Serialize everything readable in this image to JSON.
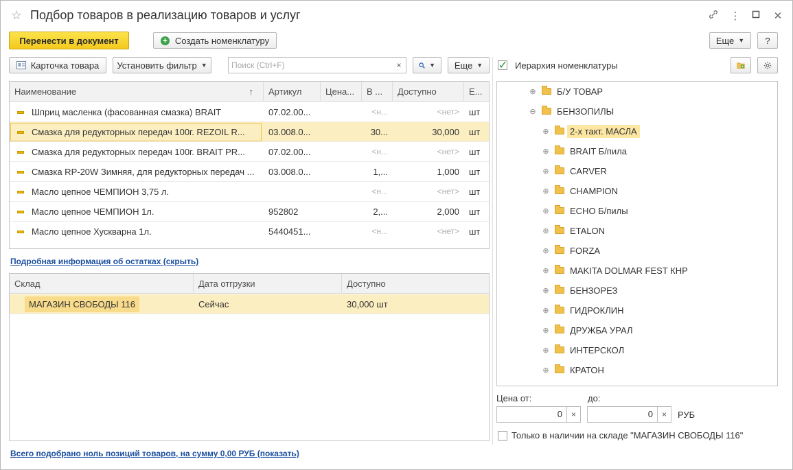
{
  "window": {
    "title": "Подбор товаров в реализацию товаров и услуг",
    "star_icon": "☆",
    "link_icon": "🔗",
    "more_icon": "⋮",
    "maximize_icon": "☐",
    "close_icon": "✕"
  },
  "toolbar": {
    "transfer_label": "Перенести в документ",
    "create_item_label": "Создать номенклатуру",
    "more_label": "Еще",
    "help_label": "?"
  },
  "list_toolbar": {
    "item_card_label": "Карточка товара",
    "set_filter_label": "Установить фильтр",
    "search_placeholder": "Поиск (Ctrl+F)",
    "search_value": "",
    "clear_label": "×",
    "search_icon_glyph": "🔍",
    "more_label": "Еще"
  },
  "goods_table": {
    "columns": [
      "Наименование",
      "Артикул",
      "Цена...",
      "В ...",
      "Доступно",
      "Е..."
    ],
    "sort_arrow": "↑",
    "rows": [
      {
        "name": "Шприц масленка (фасованная смазка) BRAIT",
        "article": "07.02.00...",
        "price": "",
        "in": "<н...",
        "available": "<нет>",
        "unit": "шт"
      },
      {
        "name": "Смазка для редукторных передач  100г.  REZOIL R...",
        "article": "03.008.0...",
        "price": "",
        "in": "30...",
        "available": "30,000",
        "unit": "шт"
      },
      {
        "name": "Смазка для редукторных передач  100г.  BRAIT PR...",
        "article": "07.02.00...",
        "price": "",
        "in": "<н...",
        "available": "<нет>",
        "unit": "шт"
      },
      {
        "name": "Смазка RP-20W Зимняя, для редукторных передач ...",
        "article": "03.008.0...",
        "price": "",
        "in": "1,...",
        "available": "1,000",
        "unit": "шт"
      },
      {
        "name": "Масло цепное ЧЕМПИОН   3,75 л.",
        "article": "",
        "price": "",
        "in": "<н...",
        "available": "<нет>",
        "unit": "шт"
      },
      {
        "name": "Масло цепное ЧЕМПИОН    1л.",
        "article": "952802",
        "price": "",
        "in": "2,...",
        "available": "2,000",
        "unit": "шт"
      },
      {
        "name": "Масло цепное Хускварна 1л.",
        "article": "5440451...",
        "price": "",
        "in": "<н...",
        "available": "<нет>",
        "unit": "шт"
      }
    ]
  },
  "stock_link": "Подробная информация об остатках (скрыть)",
  "stock_table": {
    "columns": [
      "Склад",
      "Дата отгрузки",
      "Доступно"
    ],
    "rows": [
      {
        "warehouse": "МАГАЗИН  СВОБОДЫ 116",
        "ship_date": "Сейчас",
        "available": "30,000 шт"
      }
    ]
  },
  "summary_link": "Всего подобрано ноль позиций товаров, на сумму 0,00 РУБ (показать)",
  "hierarchy": {
    "checkbox_label": "Иерархия номенклатуры",
    "checked": true,
    "items": [
      {
        "label": "Б/У ТОВАР",
        "toggle": "⊕",
        "level": 0
      },
      {
        "label": "БЕНЗОПИЛЫ",
        "toggle": "⊖",
        "level": 0
      },
      {
        "label": "2-х такт. МАСЛА",
        "toggle": "⊕",
        "level": 1,
        "selected": true
      },
      {
        "label": "BRAIT Б/пила",
        "toggle": "⊕",
        "level": 1
      },
      {
        "label": "CARVER",
        "toggle": "⊕",
        "level": 1
      },
      {
        "label": "CHAMPION",
        "toggle": "⊕",
        "level": 1
      },
      {
        "label": "ECHO Б/пилы",
        "toggle": "⊕",
        "level": 1
      },
      {
        "label": "ETALON",
        "toggle": "⊕",
        "level": 1
      },
      {
        "label": "FORZA",
        "toggle": "⊕",
        "level": 1
      },
      {
        "label": "MAKITA DOLMAR FEST  КНР",
        "toggle": "⊕",
        "level": 1
      },
      {
        "label": "БЕНЗОРЕЗ",
        "toggle": "⊕",
        "level": 1
      },
      {
        "label": "ГИДРОКЛИН",
        "toggle": "⊕",
        "level": 1
      },
      {
        "label": "ДРУЖБА УРАЛ",
        "toggle": "⊕",
        "level": 1
      },
      {
        "label": "ИНТЕРСКОЛ",
        "toggle": "⊕",
        "level": 1
      },
      {
        "label": "КРАТОН",
        "toggle": "⊕",
        "level": 1
      }
    ]
  },
  "price_filter": {
    "from_label": "Цена от:",
    "to_label": "до:",
    "from_value": "0",
    "to_value": "0",
    "currency": "РУБ",
    "clear_label": "×"
  },
  "in_stock_only": {
    "label": "Только в наличии на складе \"МАГАЗИН  СВОБОДЫ 116\"",
    "checked": false
  },
  "colors": {
    "accent_yellow": "#f4c91d",
    "selected_row": "#fbeec1",
    "link_blue": "#1c4fa0",
    "check_green": "#2f8f3a"
  }
}
